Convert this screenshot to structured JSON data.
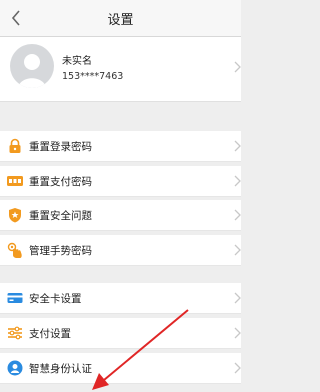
{
  "header": {
    "title": "设置"
  },
  "profile": {
    "name": "未实名",
    "phone": "153****7463"
  },
  "group1": [
    {
      "label": "重置登录密码",
      "icon": "lock-icon"
    },
    {
      "label": "重置支付密码",
      "icon": "pin-dots-icon"
    },
    {
      "label": "重置安全问题",
      "icon": "shield-icon"
    },
    {
      "label": "管理手势密码",
      "icon": "gesture-hand-icon"
    }
  ],
  "group2": [
    {
      "label": "安全卡设置",
      "icon": "card-icon"
    },
    {
      "label": "支付设置",
      "icon": "sliders-icon"
    },
    {
      "label": "智慧身份认证",
      "icon": "identity-icon"
    }
  ],
  "colors": {
    "accent": "#f29a1f",
    "blue": "#2a8be0",
    "arrow": "#e02626"
  }
}
